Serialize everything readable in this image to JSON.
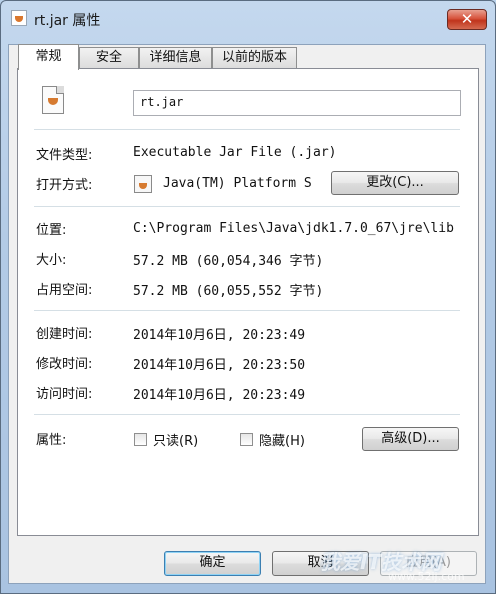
{
  "window": {
    "title": "rt.jar 属性",
    "close_glyph": "✕"
  },
  "tabs": [
    {
      "label": "常规",
      "active": true
    },
    {
      "label": "安全",
      "active": false
    },
    {
      "label": "详细信息",
      "active": false
    },
    {
      "label": "以前的版本",
      "active": false
    }
  ],
  "general": {
    "file_name": "rt.jar",
    "file_icon": "java-jar-file-icon",
    "type_label": "文件类型:",
    "type_value": "Executable Jar File (.jar)",
    "open_with_label": "打开方式:",
    "open_with_value": "Java(TM) Platform S",
    "open_with_icon": "java-icon",
    "change_button": "更改(C)...",
    "location_label": "位置:",
    "location_value": "C:\\Program Files\\Java\\jdk1.7.0_67\\jre\\lib",
    "size_label": "大小:",
    "size_value": "57.2 MB (60,054,346 字节)",
    "size_on_disk_label": "占用空间:",
    "size_on_disk_value": "57.2 MB (60,055,552 字节)",
    "created_label": "创建时间:",
    "created_value": "2014年10月6日, 20:23:49",
    "modified_label": "修改时间:",
    "modified_value": "2014年10月6日, 20:23:50",
    "accessed_label": "访问时间:",
    "accessed_value": "2014年10月6日, 20:23:49",
    "attributes_label": "属性:",
    "readonly_label": "只读(R)",
    "readonly_checked": false,
    "hidden_label": "隐藏(H)",
    "hidden_checked": false,
    "advanced_button": "高级(D)..."
  },
  "footer": {
    "ok_button": "确定",
    "cancel_button": "取消",
    "apply_button": "应用(A)"
  },
  "watermark": {
    "text": "我爱IT技术网",
    "sub": "www.52ij.com"
  }
}
